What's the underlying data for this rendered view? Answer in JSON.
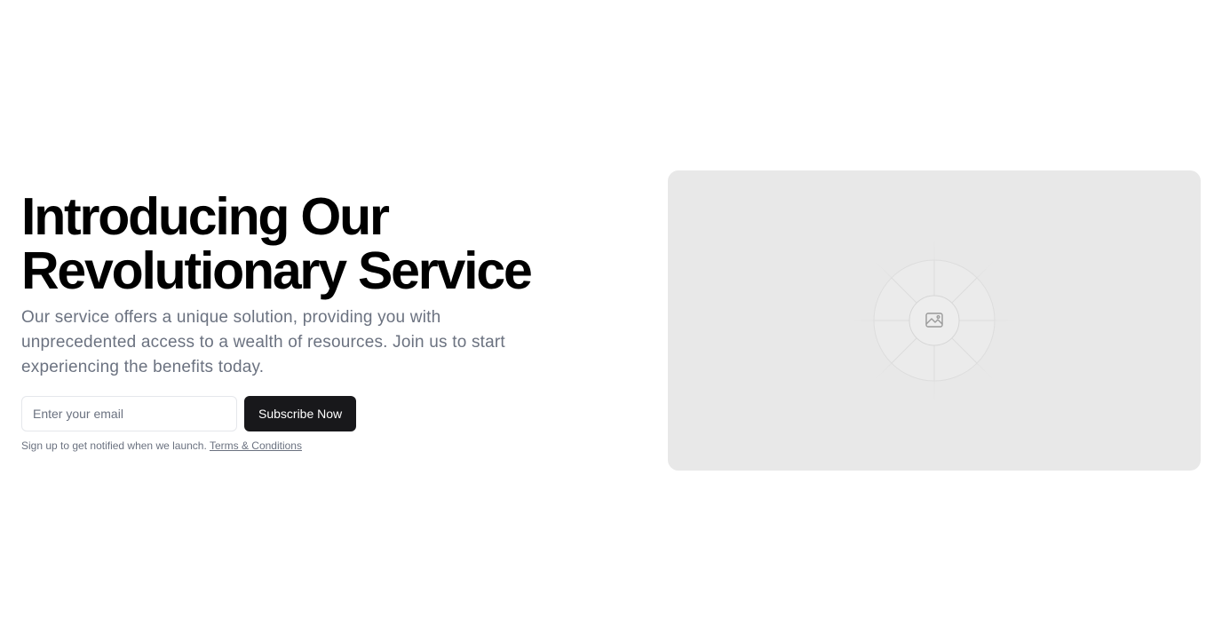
{
  "hero": {
    "title_line1": "Introducing Our",
    "title_line2": "Revolutionary Service",
    "description": "Our service offers a unique solution, providing you with unprecedented access to a wealth of resources. Join us to start experiencing the benefits today."
  },
  "signup": {
    "email_placeholder": "Enter your email",
    "email_value": "",
    "button_label": "Subscribe Now",
    "note": "Sign up to get notified when we launch.",
    "terms_link": "Terms & Conditions"
  },
  "media": {
    "icon": "image-icon"
  },
  "colors": {
    "heading": "#000000",
    "muted_text": "#6b7280",
    "button_bg": "#18181b",
    "button_text": "#ffffff",
    "placeholder_bg": "#e8e8e8",
    "input_border": "#e5e7eb"
  }
}
